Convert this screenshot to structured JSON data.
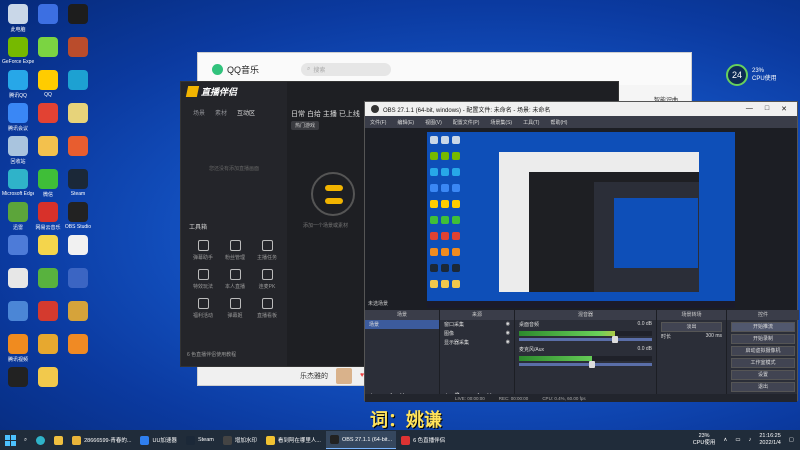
{
  "desktop_icons": [
    {
      "label": "此电脑",
      "color": "#c9d7e8"
    },
    {
      "label": "GeForce Experience",
      "color": "#76b900"
    },
    {
      "label": "腾讯QQ",
      "color": "#27a7e8"
    },
    {
      "label": "腾讯会议",
      "color": "#3a87f5"
    },
    {
      "label": "回收站",
      "color": "#a9c4de"
    },
    {
      "label": "Microsoft Edge",
      "color": "#2fb3c9"
    },
    {
      "label": "迅雷",
      "color": "#5ca53a"
    },
    {
      "label": "",
      "color": "#4d7bd8"
    },
    {
      "label": "",
      "color": "#e7e7e7"
    },
    {
      "label": "",
      "color": "#4b86d6"
    },
    {
      "label": "腾讯视频",
      "color": "#f08b1f"
    },
    {
      "label": "",
      "color": "#222"
    },
    {
      "label": "",
      "color": "#3c6fe2"
    },
    {
      "label": "",
      "color": "#7bd442"
    },
    {
      "label": "QQ",
      "color": "#ffcc00"
    },
    {
      "label": "",
      "color": "#e24233"
    },
    {
      "label": "",
      "color": "#f3c14d"
    },
    {
      "label": "微信",
      "color": "#3fbe38"
    },
    {
      "label": "网易云音乐",
      "color": "#d8312a"
    },
    {
      "label": "",
      "color": "#f4d54c"
    },
    {
      "label": "",
      "color": "#58b23e"
    },
    {
      "label": "",
      "color": "#d43a2e"
    },
    {
      "label": "",
      "color": "#e7a82f"
    },
    {
      "label": "",
      "color": "#f2c94c"
    },
    {
      "label": "",
      "color": "#1d1d1d"
    },
    {
      "label": "",
      "color": "#ba4c2c"
    },
    {
      "label": "",
      "color": "#1da1d2"
    },
    {
      "label": "",
      "color": "#e7d37a"
    },
    {
      "label": "",
      "color": "#e85d2f"
    },
    {
      "label": "Steam",
      "color": "#1b2838"
    },
    {
      "label": "OBS Studio",
      "color": "#222"
    },
    {
      "label": "",
      "color": "#f1f1f1"
    },
    {
      "label": "",
      "color": "#3b65c3"
    },
    {
      "label": "",
      "color": "#d6a33a"
    },
    {
      "label": "",
      "color": "#f08a24"
    }
  ],
  "cpu_widget": {
    "value": "24",
    "percent": "23%",
    "label": "CPU使用"
  },
  "qq_music": {
    "title": "QQ音乐",
    "search_placeholder": "搜索",
    "right_label": "智能识曲",
    "user": "乐杰雅的"
  },
  "companion": {
    "brand": "直播伴侣",
    "tabs": [
      "场景",
      "素材",
      "互动区"
    ],
    "header": "日常 白给 主播 已上线",
    "tag": "热门游戏",
    "hint": "您还没有添加直播画面",
    "orb_text": "添加一个场景或素材",
    "tools_label": "工具箱",
    "tools": [
      {
        "label": "弹幕助手"
      },
      {
        "label": "粉丝管理"
      },
      {
        "label": "主播任务"
      },
      {
        "label": "特效玩法"
      },
      {
        "label": "本人直播"
      },
      {
        "label": "连麦PK"
      },
      {
        "label": "福利活动"
      },
      {
        "label": "弹幕姬"
      },
      {
        "label": "直播看板"
      }
    ],
    "exit_text": "6 色直播伴侣使用教程"
  },
  "obs": {
    "title": "OBS 27.1.1 (64-bit, windows) - 配置文件: 未命名 - 场景: 未命名",
    "menu": [
      "文件(F)",
      "编辑(E)",
      "视图(V)",
      "配置文件(P)",
      "场景集(S)",
      "工具(T)",
      "帮助(H)"
    ],
    "scenes_header": "场景",
    "scenes": [
      "场景"
    ],
    "sources_header": "来源",
    "sources": [
      "窗口采集",
      "图像",
      "显示器采集"
    ],
    "mixer_header": "混音器",
    "mixer": [
      {
        "name": "桌面音频",
        "db": "0.0 dB",
        "level": 0.72
      },
      {
        "name": "麦克风/Aux",
        "db": "0.0 dB",
        "level": 0.55
      }
    ],
    "transitions_header": "场景转场",
    "transition_type": "淡出",
    "duration_label": "时长",
    "duration": "300 ms",
    "controls_header": "控件",
    "controls": [
      "开始推流",
      "开始录制",
      "启动虚拟摄像机",
      "工作室模式",
      "设置",
      "退出"
    ],
    "status": [
      "LIVE: 00:00:00",
      "REC: 00:00:00",
      "CPU: 0.4%, 60.00 fps"
    ],
    "current_scene": "未选场景"
  },
  "subtitle": "词：姚谦",
  "taskbar": {
    "items": [
      {
        "label": "28666599-青春的...",
        "color": "#e9b43a"
      },
      {
        "label": "UU加速器",
        "color": "#2f7ff0"
      },
      {
        "label": "Steam",
        "color": "#1b2838"
      },
      {
        "label": "增加水印",
        "color": "#444"
      },
      {
        "label": "看到阿在哪里人...",
        "color": "#f1c232"
      },
      {
        "label": "OBS 27.1.1 (64-bit...",
        "color": "#222",
        "active": true
      },
      {
        "label": "6 色直播伴侣",
        "color": "#d33"
      }
    ],
    "cpu": "23%",
    "cpu_label": "CPU使用",
    "time": "21:16:25",
    "date": "2022/1/4"
  }
}
